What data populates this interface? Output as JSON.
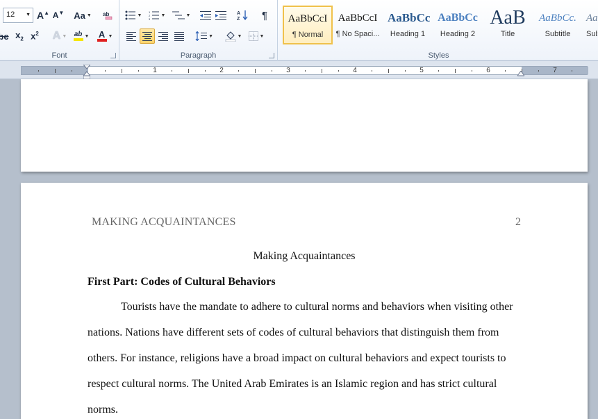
{
  "ribbon": {
    "font_group": {
      "label": "Font",
      "font_size": "12",
      "grow_font": "A",
      "shrink_font": "A",
      "change_case": "Aa",
      "text_effects": "A",
      "highlight": "ab",
      "font_color": "A",
      "highlight_color": "#f5e600",
      "font_color_value": "#e02020"
    },
    "paragraph_group": {
      "label": "Paragraph",
      "show_marks": "¶"
    },
    "styles_group": {
      "label": "Styles",
      "items": [
        {
          "sample": "AaBbCcI",
          "name": "¶ Normal",
          "selected": true
        },
        {
          "sample": "AaBbCcI",
          "name": "¶ No Spaci..."
        },
        {
          "sample": "AaBbCc",
          "name": "Heading 1"
        },
        {
          "sample": "AaBbCc",
          "name": "Heading 2"
        },
        {
          "sample": "AaB",
          "name": "Title"
        },
        {
          "sample": "AaBbCc.",
          "name": "Subtitle"
        },
        {
          "sample": "Aa",
          "name": "Sub"
        }
      ]
    }
  },
  "ruler": {
    "labels": [
      "1",
      "2",
      "3",
      "4",
      "5",
      "6",
      "7"
    ]
  },
  "document": {
    "running_head": "MAKING ACQUAINTANCES",
    "page_number": "2",
    "title": "Making Acquaintances",
    "heading": "First Part: Codes of Cultural Behaviors",
    "paragraph_lines": [
      "Tourists have the mandate to adhere to cultural norms and behaviors when visiting other",
      "nations. Nations have different sets of codes of cultural behaviors that distinguish them from",
      "others. For instance, religions have a broad impact on cultural behaviors and expect tourists to",
      "respect cultural norms. The United Arab Emirates is an Islamic region and has strict cultural",
      "norms."
    ]
  }
}
